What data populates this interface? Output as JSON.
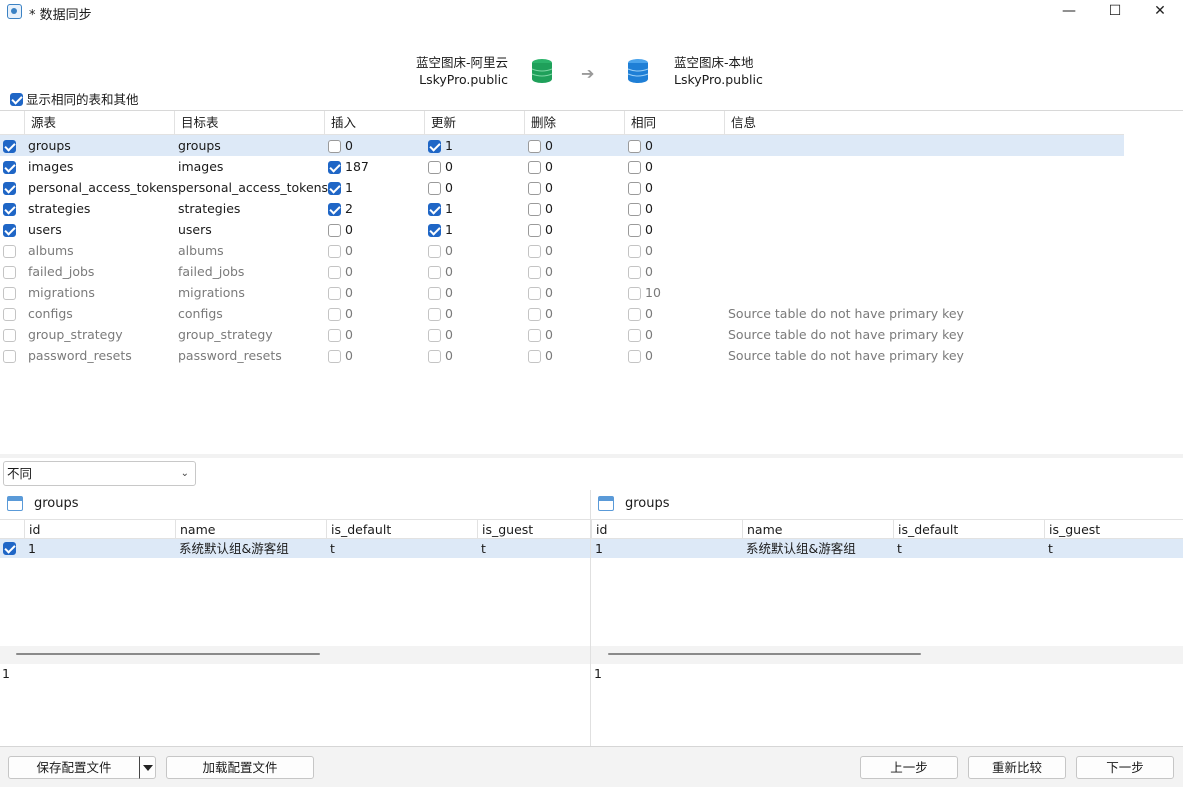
{
  "window": {
    "title": "* 数据同步",
    "minimize_glyph": "—",
    "maximize_glyph": "☐",
    "close_glyph": "✕"
  },
  "source": {
    "name": "蓝空图床-阿里云",
    "schema": "LskyPro.public",
    "icon": "database-icon",
    "color": "#1fa05a"
  },
  "target": {
    "name": "蓝空图床-本地",
    "schema": "LskyPro.public",
    "icon": "database-icon",
    "color": "#1f7fd6"
  },
  "arrow": "➔",
  "show_same": {
    "label": "显示相同的表和其他",
    "checked": true
  },
  "table": {
    "columns": [
      "源表",
      "目标表",
      "插入",
      "更新",
      "删除",
      "相同",
      "信息"
    ],
    "rows": [
      {
        "checked": true,
        "enabled": true,
        "source": "groups",
        "target": "groups",
        "insert_checked": false,
        "insert": "0",
        "update_checked": true,
        "update": "1",
        "delete_checked": false,
        "delete": "0",
        "same_checked": false,
        "same": "0",
        "info": "",
        "selected": true
      },
      {
        "checked": true,
        "enabled": true,
        "source": "images",
        "target": "images",
        "insert_checked": true,
        "insert": "187",
        "update_checked": false,
        "update": "0",
        "delete_checked": false,
        "delete": "0",
        "same_checked": false,
        "same": "0",
        "info": ""
      },
      {
        "checked": true,
        "enabled": true,
        "source": "personal_access_tokens",
        "target": "personal_access_tokens",
        "insert_checked": true,
        "insert": "1",
        "update_checked": false,
        "update": "0",
        "delete_checked": false,
        "delete": "0",
        "same_checked": false,
        "same": "0",
        "info": ""
      },
      {
        "checked": true,
        "enabled": true,
        "source": "strategies",
        "target": "strategies",
        "insert_checked": true,
        "insert": "2",
        "update_checked": true,
        "update": "1",
        "delete_checked": false,
        "delete": "0",
        "same_checked": false,
        "same": "0",
        "info": ""
      },
      {
        "checked": true,
        "enabled": true,
        "source": "users",
        "target": "users",
        "insert_checked": false,
        "insert": "0",
        "update_checked": true,
        "update": "1",
        "delete_checked": false,
        "delete": "0",
        "same_checked": false,
        "same": "0",
        "info": ""
      },
      {
        "checked": false,
        "enabled": false,
        "source": "albums",
        "target": "albums",
        "insert_checked": false,
        "insert": "0",
        "update_checked": false,
        "update": "0",
        "delete_checked": false,
        "delete": "0",
        "same_checked": false,
        "same": "0",
        "info": ""
      },
      {
        "checked": false,
        "enabled": false,
        "source": "failed_jobs",
        "target": "failed_jobs",
        "insert_checked": false,
        "insert": "0",
        "update_checked": false,
        "update": "0",
        "delete_checked": false,
        "delete": "0",
        "same_checked": false,
        "same": "0",
        "info": ""
      },
      {
        "checked": false,
        "enabled": false,
        "source": "migrations",
        "target": "migrations",
        "insert_checked": false,
        "insert": "0",
        "update_checked": false,
        "update": "0",
        "delete_checked": false,
        "delete": "0",
        "same_checked": false,
        "same": "10",
        "info": ""
      },
      {
        "checked": false,
        "enabled": false,
        "source": "configs",
        "target": "configs",
        "insert_checked": false,
        "insert": "0",
        "update_checked": false,
        "update": "0",
        "delete_checked": false,
        "delete": "0",
        "same_checked": false,
        "same": "0",
        "info": "Source table do not have primary key"
      },
      {
        "checked": false,
        "enabled": false,
        "source": "group_strategy",
        "target": "group_strategy",
        "insert_checked": false,
        "insert": "0",
        "update_checked": false,
        "update": "0",
        "delete_checked": false,
        "delete": "0",
        "same_checked": false,
        "same": "0",
        "info": "Source table do not have primary key"
      },
      {
        "checked": false,
        "enabled": false,
        "source": "password_resets",
        "target": "password_resets",
        "insert_checked": false,
        "insert": "0",
        "update_checked": false,
        "update": "0",
        "delete_checked": false,
        "delete": "0",
        "same_checked": false,
        "same": "0",
        "info": "Source table do not have primary key"
      }
    ]
  },
  "filter": {
    "value": "不同",
    "chevron": "⌄"
  },
  "left_pane": {
    "table_name": "groups",
    "columns": [
      "id",
      "name",
      "is_default",
      "is_guest"
    ],
    "row": {
      "checked": true,
      "values": [
        "1",
        "系统默认组&游客组",
        "t",
        "t"
      ]
    },
    "detail": "1"
  },
  "right_pane": {
    "table_name": "groups",
    "columns": [
      "id",
      "name",
      "is_default",
      "is_guest"
    ],
    "row": {
      "values": [
        "1",
        "系统默认组&游客组",
        "t",
        "t"
      ]
    },
    "detail": "1"
  },
  "footer": {
    "save_profile": "保存配置文件",
    "load_profile": "加载配置文件",
    "back": "上一步",
    "recompare": "重新比较",
    "next": "下一步"
  }
}
